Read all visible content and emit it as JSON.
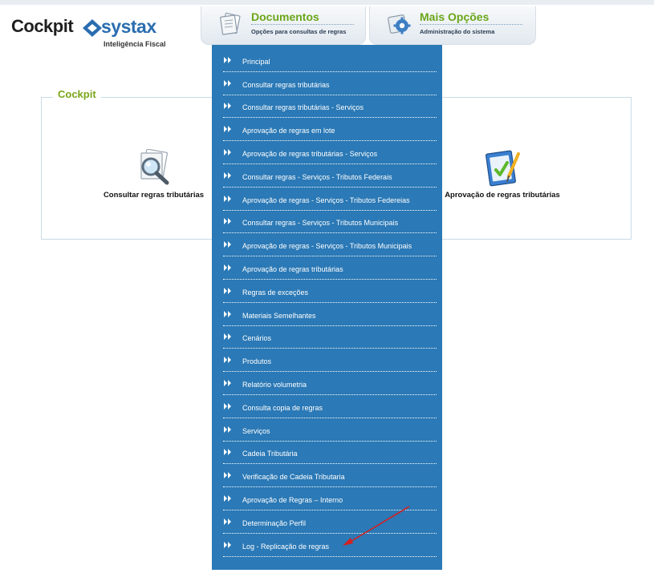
{
  "logo": {
    "brand_left": "Cockpit",
    "brand_right": "systax",
    "tagline": "Inteligência Fiscal"
  },
  "tabs": [
    {
      "title": "Documentos",
      "description": "Opções para consultas de regras",
      "icon": "documents-icon"
    },
    {
      "title": "Mais Opções",
      "description": "Administração do sistema",
      "icon": "gear-icon"
    }
  ],
  "panel": {
    "title": "Cockpit",
    "tiles": [
      {
        "label": "Consultar regras tributárias",
        "icon": "magnifier-documents-icon"
      },
      {
        "label": "Aprovação de regras tributárias",
        "icon": "checklist-pen-icon"
      }
    ]
  },
  "menu": {
    "items": [
      "Principal",
      "Consultar regras tributárias",
      "Consultar regras tributárias - Serviços",
      "Aprovação de regras em lote",
      "Aprovação de regras tributárias - Serviços",
      "Consultar regras - Serviços - Tributos Federais",
      "Aprovação de regras - Serviços - Tributos Federeias",
      "Consultar regras - Serviços - Tributos Municipais",
      "Aprovação de regras - Serviços - Tributos Municipais",
      "Aprovação de regras tributárias",
      "Regras de exceções",
      "Materiais Semelhantes",
      "Cenários",
      "Produtos",
      "Relatório volumetria",
      "Consulta copia de regras",
      "Serviços",
      "Cadeia Tributária",
      "Verificação de Cadeia Tributaria",
      "Aprovação de Regras – Interno",
      "Determinação Perfil",
      "Log - Replicação de regras"
    ]
  },
  "colors": {
    "menu_bg": "#2b79b6",
    "accent_green": "#6aa61a",
    "brand_blue": "#2a6db0",
    "annotation_arrow": "#d42020"
  }
}
